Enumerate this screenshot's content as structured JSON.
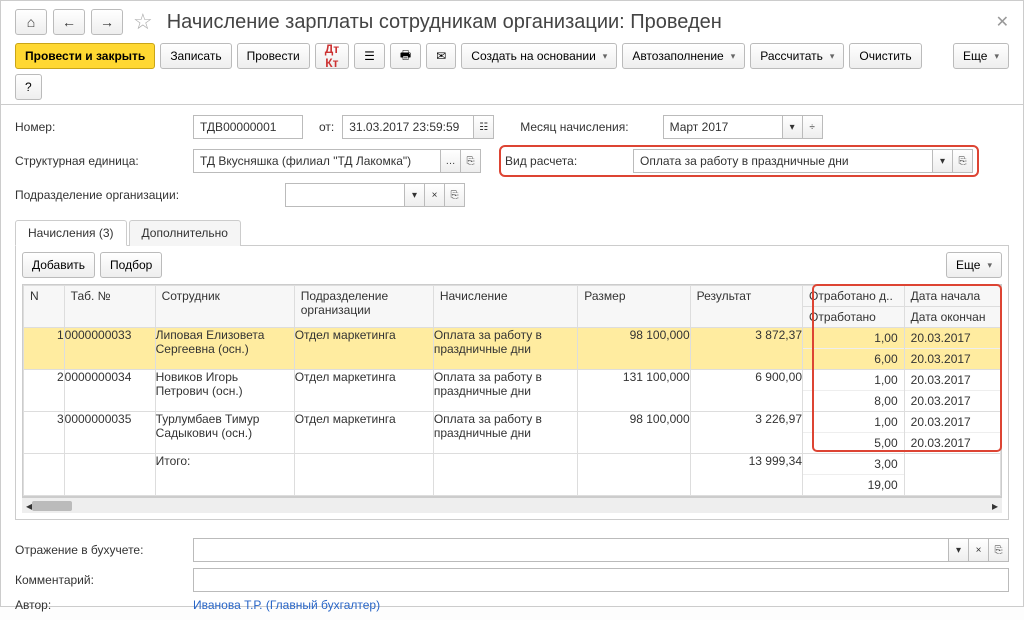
{
  "window_title": "Начисление зарплаты сотрудникам организации: Проведен",
  "toolbar": {
    "post_close": "Провести и закрыть",
    "write": "Записать",
    "post": "Провести",
    "create_based": "Создать на основании",
    "autofill": "Автозаполнение",
    "calculate": "Рассчитать",
    "clear": "Очистить",
    "more": "Еще"
  },
  "fields": {
    "number_label": "Номер:",
    "number_value": "ТДВ00000001",
    "date_label": "от:",
    "date_value": "31.03.2017 23:59:59",
    "month_label": "Месяц начисления:",
    "month_value": "Март 2017",
    "unit_label": "Структурная единица:",
    "unit_value": "ТД Вкусняшка (филиал \"ТД Лакомка\")",
    "calc_type_label": "Вид расчета:",
    "calc_type_value": "Оплата за работу в праздничные дни",
    "dept_label": "Подразделение организации:",
    "dept_value": ""
  },
  "tabs": {
    "accruals": "Начисления (3)",
    "extra": "Дополнительно"
  },
  "sub_toolbar": {
    "add": "Добавить",
    "pick": "Подбор",
    "more": "Еще"
  },
  "columns": {
    "n": "N",
    "tab_no": "Таб. №",
    "employee": "Сотрудник",
    "dept": "Подразделение организации",
    "accrual": "Начисление",
    "size": "Размер",
    "result": "Результат",
    "worked_d": "Отработано д..",
    "worked": "Отработано",
    "date_start": "Дата начала",
    "date_end": "Дата окончан"
  },
  "rows": [
    {
      "n": "1",
      "tab": "0000000033",
      "emp": "Липовая Елизовета Сергеевна (осн.)",
      "dept": "Отдел маркетинга",
      "acc": "Оплата за работу в праздничные дни",
      "size": "98 100,000",
      "res": "3 872,37",
      "w1": "1,00",
      "w2": "6,00",
      "d1": "20.03.2017",
      "d2": "20.03.2017"
    },
    {
      "n": "2",
      "tab": "0000000034",
      "emp": "Новиков Игорь Петрович (осн.)",
      "dept": "Отдел маркетинга",
      "acc": "Оплата за работу в праздничные дни",
      "size": "131 100,000",
      "res": "6 900,00",
      "w1": "1,00",
      "w2": "8,00",
      "d1": "20.03.2017",
      "d2": "20.03.2017"
    },
    {
      "n": "3",
      "tab": "0000000035",
      "emp": "Турлумбаев Тимур Садыкович (осн.)",
      "dept": "Отдел маркетинга",
      "acc": "Оплата за работу в праздничные дни",
      "size": "98 100,000",
      "res": "3 226,97",
      "w1": "1,00",
      "w2": "5,00",
      "d1": "20.03.2017",
      "d2": "20.03.2017"
    }
  ],
  "totals": {
    "label": "Итого:",
    "result": "13 999,34",
    "w1": "3,00",
    "w2": "19,00"
  },
  "footer": {
    "accounting_label": "Отражение в бухучете:",
    "comment_label": "Комментарий:",
    "author_label": "Автор:",
    "author_value": "Иванова Т.Р. (Главный бухгалтер)"
  }
}
